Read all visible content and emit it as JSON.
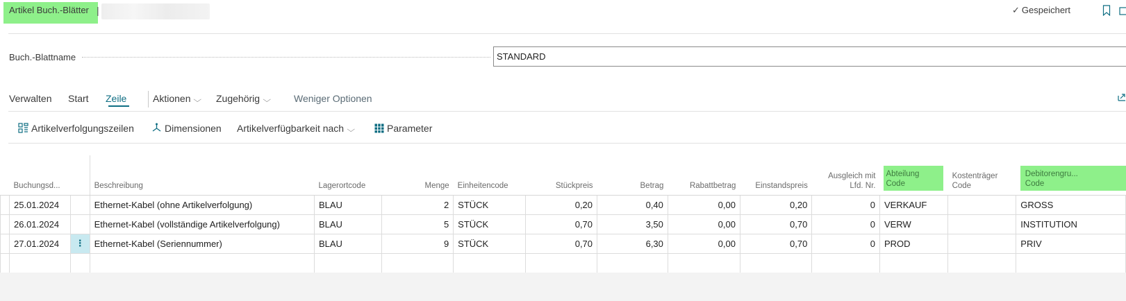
{
  "header": {
    "title": "Artikel Buch.-Blätter",
    "title_separator": "|",
    "saved_label": "Gespeichert"
  },
  "batch": {
    "label": "Buch.-Blattname",
    "value": "STANDARD"
  },
  "actionbar": {
    "items": [
      "Verwalten",
      "Start",
      "Zeile",
      "Aktionen",
      "Zugehörig",
      "Weniger Optionen"
    ],
    "active": "Zeile"
  },
  "subbar": {
    "items": [
      "Artikelverfolgungszeilen",
      "Dimensionen",
      "Artikelverfügbarkeit nach",
      "Parameter"
    ]
  },
  "table": {
    "columns": [
      "Buchungsd...",
      "Beschreibung",
      "Lagerortcode",
      "Menge",
      "Einheitencode",
      "Stückpreis",
      "Betrag",
      "Rabattbetrag",
      "Einstandspreis",
      "Ausgleich mit",
      "Lfd. Nr.",
      "Abteilung",
      "Code",
      "Kostenträger",
      "Code",
      "Debitorengru...",
      "Code"
    ],
    "rows": [
      {
        "date": "25.01.2024",
        "desc": "Ethernet-Kabel (ohne Artikelverfolgung)",
        "loc": "BLAU",
        "qty": "2",
        "unit": "STÜCK",
        "price": "0,20",
        "amount": "0,40",
        "discount": "0,00",
        "cost": "0,20",
        "apply": "0",
        "dept": "VERKAUF",
        "cc": "",
        "cust": "GROSS"
      },
      {
        "date": "26.01.2024",
        "desc": "Ethernet-Kabel (vollständige Artikelverfolgung)",
        "loc": "BLAU",
        "qty": "5",
        "unit": "STÜCK",
        "price": "0,70",
        "amount": "3,50",
        "discount": "0,00",
        "cost": "0,70",
        "apply": "0",
        "dept": "VERW",
        "cc": "",
        "cust": "INSTITUTION"
      },
      {
        "date": "27.01.2024",
        "desc": "Ethernet-Kabel (Seriennummer)",
        "loc": "BLAU",
        "qty": "9",
        "unit": "STÜCK",
        "price": "0,70",
        "amount": "6,30",
        "discount": "0,00",
        "cost": "0,70",
        "apply": "0",
        "dept": "PROD",
        "cc": "",
        "cust": "PRIV"
      }
    ],
    "row_menu_glyph": "⋮"
  },
  "colors": {
    "highlight": "#8ef08a",
    "accent": "#0f6e83",
    "selected_cell": "#c8e9f0"
  }
}
